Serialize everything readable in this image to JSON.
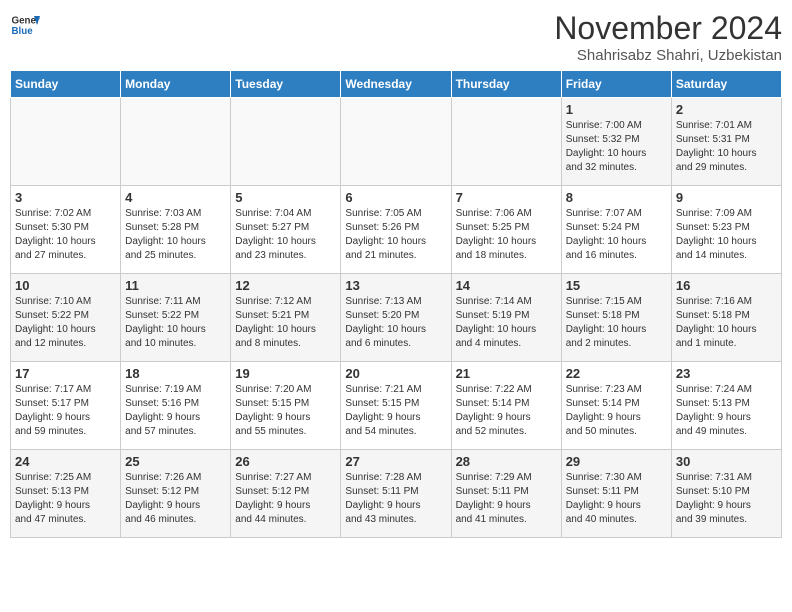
{
  "header": {
    "logo_line1": "General",
    "logo_line2": "Blue",
    "month_title": "November 2024",
    "location": "Shahrisabz Shahri, Uzbekistan"
  },
  "days_of_week": [
    "Sunday",
    "Monday",
    "Tuesday",
    "Wednesday",
    "Thursday",
    "Friday",
    "Saturday"
  ],
  "weeks": [
    [
      {
        "day": "",
        "info": ""
      },
      {
        "day": "",
        "info": ""
      },
      {
        "day": "",
        "info": ""
      },
      {
        "day": "",
        "info": ""
      },
      {
        "day": "",
        "info": ""
      },
      {
        "day": "1",
        "info": "Sunrise: 7:00 AM\nSunset: 5:32 PM\nDaylight: 10 hours\nand 32 minutes."
      },
      {
        "day": "2",
        "info": "Sunrise: 7:01 AM\nSunset: 5:31 PM\nDaylight: 10 hours\nand 29 minutes."
      }
    ],
    [
      {
        "day": "3",
        "info": "Sunrise: 7:02 AM\nSunset: 5:30 PM\nDaylight: 10 hours\nand 27 minutes."
      },
      {
        "day": "4",
        "info": "Sunrise: 7:03 AM\nSunset: 5:28 PM\nDaylight: 10 hours\nand 25 minutes."
      },
      {
        "day": "5",
        "info": "Sunrise: 7:04 AM\nSunset: 5:27 PM\nDaylight: 10 hours\nand 23 minutes."
      },
      {
        "day": "6",
        "info": "Sunrise: 7:05 AM\nSunset: 5:26 PM\nDaylight: 10 hours\nand 21 minutes."
      },
      {
        "day": "7",
        "info": "Sunrise: 7:06 AM\nSunset: 5:25 PM\nDaylight: 10 hours\nand 18 minutes."
      },
      {
        "day": "8",
        "info": "Sunrise: 7:07 AM\nSunset: 5:24 PM\nDaylight: 10 hours\nand 16 minutes."
      },
      {
        "day": "9",
        "info": "Sunrise: 7:09 AM\nSunset: 5:23 PM\nDaylight: 10 hours\nand 14 minutes."
      }
    ],
    [
      {
        "day": "10",
        "info": "Sunrise: 7:10 AM\nSunset: 5:22 PM\nDaylight: 10 hours\nand 12 minutes."
      },
      {
        "day": "11",
        "info": "Sunrise: 7:11 AM\nSunset: 5:22 PM\nDaylight: 10 hours\nand 10 minutes."
      },
      {
        "day": "12",
        "info": "Sunrise: 7:12 AM\nSunset: 5:21 PM\nDaylight: 10 hours\nand 8 minutes."
      },
      {
        "day": "13",
        "info": "Sunrise: 7:13 AM\nSunset: 5:20 PM\nDaylight: 10 hours\nand 6 minutes."
      },
      {
        "day": "14",
        "info": "Sunrise: 7:14 AM\nSunset: 5:19 PM\nDaylight: 10 hours\nand 4 minutes."
      },
      {
        "day": "15",
        "info": "Sunrise: 7:15 AM\nSunset: 5:18 PM\nDaylight: 10 hours\nand 2 minutes."
      },
      {
        "day": "16",
        "info": "Sunrise: 7:16 AM\nSunset: 5:18 PM\nDaylight: 10 hours\nand 1 minute."
      }
    ],
    [
      {
        "day": "17",
        "info": "Sunrise: 7:17 AM\nSunset: 5:17 PM\nDaylight: 9 hours\nand 59 minutes."
      },
      {
        "day": "18",
        "info": "Sunrise: 7:19 AM\nSunset: 5:16 PM\nDaylight: 9 hours\nand 57 minutes."
      },
      {
        "day": "19",
        "info": "Sunrise: 7:20 AM\nSunset: 5:15 PM\nDaylight: 9 hours\nand 55 minutes."
      },
      {
        "day": "20",
        "info": "Sunrise: 7:21 AM\nSunset: 5:15 PM\nDaylight: 9 hours\nand 54 minutes."
      },
      {
        "day": "21",
        "info": "Sunrise: 7:22 AM\nSunset: 5:14 PM\nDaylight: 9 hours\nand 52 minutes."
      },
      {
        "day": "22",
        "info": "Sunrise: 7:23 AM\nSunset: 5:14 PM\nDaylight: 9 hours\nand 50 minutes."
      },
      {
        "day": "23",
        "info": "Sunrise: 7:24 AM\nSunset: 5:13 PM\nDaylight: 9 hours\nand 49 minutes."
      }
    ],
    [
      {
        "day": "24",
        "info": "Sunrise: 7:25 AM\nSunset: 5:13 PM\nDaylight: 9 hours\nand 47 minutes."
      },
      {
        "day": "25",
        "info": "Sunrise: 7:26 AM\nSunset: 5:12 PM\nDaylight: 9 hours\nand 46 minutes."
      },
      {
        "day": "26",
        "info": "Sunrise: 7:27 AM\nSunset: 5:12 PM\nDaylight: 9 hours\nand 44 minutes."
      },
      {
        "day": "27",
        "info": "Sunrise: 7:28 AM\nSunset: 5:11 PM\nDaylight: 9 hours\nand 43 minutes."
      },
      {
        "day": "28",
        "info": "Sunrise: 7:29 AM\nSunset: 5:11 PM\nDaylight: 9 hours\nand 41 minutes."
      },
      {
        "day": "29",
        "info": "Sunrise: 7:30 AM\nSunset: 5:11 PM\nDaylight: 9 hours\nand 40 minutes."
      },
      {
        "day": "30",
        "info": "Sunrise: 7:31 AM\nSunset: 5:10 PM\nDaylight: 9 hours\nand 39 minutes."
      }
    ]
  ]
}
